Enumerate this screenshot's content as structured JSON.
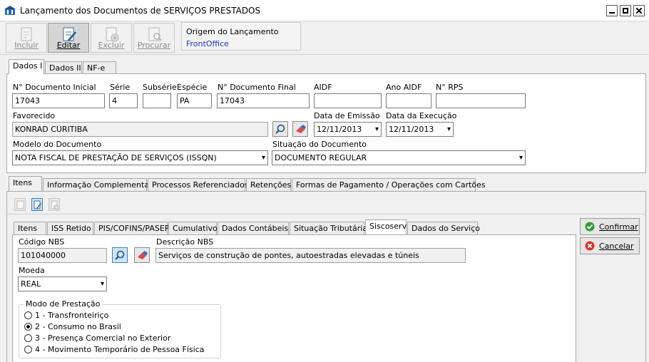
{
  "window": {
    "title": "Lançamento dos Documentos de SERVIÇOS PRESTADOS"
  },
  "toolbar": {
    "incluir": "Incluir",
    "editar": "Editar",
    "excluir": "Excluir",
    "procurar": "Procurar",
    "origin_label": "Origem do Lançamento",
    "origin_value": "FrontOffice"
  },
  "top_tabs": [
    "Dados I",
    "Dados II",
    "NF-e"
  ],
  "fields": {
    "doc_inicial": {
      "label": "N° Documento Inicial",
      "value": "17043"
    },
    "serie": {
      "label": "Série",
      "value": "4"
    },
    "subserie": {
      "label": "Subsérie",
      "value": ""
    },
    "especie": {
      "label": "Espécie",
      "value": "PA"
    },
    "doc_final": {
      "label": "N° Documento Final",
      "value": "17043"
    },
    "aidf": {
      "label": "AIDF",
      "value": ""
    },
    "ano_aidf": {
      "label": "Ano AIDF",
      "value": ""
    },
    "rps": {
      "label": "N° RPS",
      "value": ""
    },
    "favorecido": {
      "label": "Favorecido",
      "value": "KONRAD CURITIBA"
    },
    "data_emissao": {
      "label": "Data de Emissão",
      "value": "12/11/2013"
    },
    "data_execucao": {
      "label": "Data da Execução",
      "value": "12/11/2013"
    },
    "modelo": {
      "label": "Modelo do Documento",
      "value": "NOTA FISCAL DE PRESTAÇÃO DE SERVIÇOS (ISSQN)"
    },
    "situacao": {
      "label": "Situação do Documento",
      "value": "DOCUMENTO REGULAR"
    }
  },
  "mid_tabs": [
    "Itens",
    "Informação Complementar",
    "Processos Referenciados",
    "Retenções",
    "Formas de Pagamento / Operações com Cartões"
  ],
  "inner_tabs": [
    "Itens",
    "ISS Retido",
    "PIS/COFINS/PASEP",
    "Cumulativo",
    "Dados Contábeis",
    "Situação Tributária",
    "Siscoserv",
    "Dados do Serviço"
  ],
  "siscoserv": {
    "codigo_label": "Código NBS",
    "codigo_value": "101040000",
    "descricao_label": "Descrição NBS",
    "descricao_value": "Serviços de construção de pontes, autoestradas elevadas e túneis",
    "moeda_label": "Moeda",
    "moeda_value": "REAL",
    "modo_label": "Modo de Prestação",
    "modo_options": [
      "1 - Transfronteiriço",
      "2 - Consumo no Brasil",
      "3 - Presença Comercial no Exterior",
      "4 - Movimento Temporário de Pessoa Física"
    ],
    "modo_selected": "2 - Consumo no Brasil"
  },
  "actions": {
    "confirmar": "Confirmar",
    "cancelar": "Cancelar"
  },
  "colors": {
    "accent_blue": "#1a33c8",
    "confirm_green": "#2e9e3a",
    "cancel_red": "#d23a2a"
  }
}
